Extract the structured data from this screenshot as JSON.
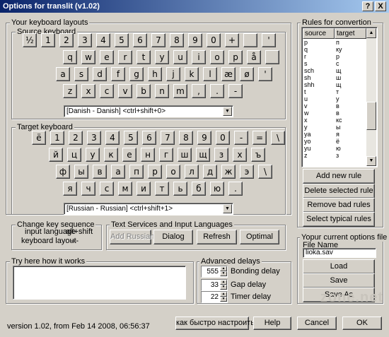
{
  "window": {
    "title": "Options for translit (v1.02)",
    "help_btn": "?",
    "close_btn": "X"
  },
  "layouts": {
    "group_label": "Your keyboard layouts",
    "source": {
      "label": "Source keyboard",
      "rows": [
        [
          "½",
          "1",
          "2",
          "3",
          "4",
          "5",
          "6",
          "7",
          "8",
          "9",
          "0",
          "+",
          "",
          "'"
        ],
        [
          "q",
          "w",
          "e",
          "r",
          "t",
          "y",
          "u",
          "i",
          "o",
          "p",
          "å",
          ""
        ],
        [
          "a",
          "s",
          "d",
          "f",
          "g",
          "h",
          "j",
          "k",
          "l",
          "æ",
          "ø",
          "'"
        ],
        [
          "z",
          "x",
          "c",
          "v",
          "b",
          "n",
          "m",
          ",",
          ".",
          "-"
        ]
      ],
      "selected": "[Danish - Danish]  <ctrl+shift+0>"
    },
    "target": {
      "label": "Target keyboard",
      "rows": [
        [
          "ё",
          "1",
          "2",
          "3",
          "4",
          "5",
          "6",
          "7",
          "8",
          "9",
          "0",
          "-",
          "=",
          "\\"
        ],
        [
          "й",
          "ц",
          "у",
          "к",
          "е",
          "н",
          "г",
          "ш",
          "щ",
          "з",
          "х",
          "ъ"
        ],
        [
          "ф",
          "ы",
          "в",
          "а",
          "п",
          "р",
          "о",
          "л",
          "д",
          "ж",
          "э",
          "\\"
        ],
        [
          "я",
          "ч",
          "с",
          "м",
          "и",
          "т",
          "ь",
          "б",
          "ю",
          "."
        ]
      ],
      "selected": "[Russian - Russian]  <ctrl+shift+1>"
    }
  },
  "key_sequence": {
    "label": "Change key sequence",
    "input_language_label": "input language",
    "input_language_value": "alt+shift",
    "keyboard_layout_label": "keyboard layout",
    "keyboard_layout_value": "---"
  },
  "text_services": {
    "label": "Text Services and Input Languages",
    "add_russian": "Add Russian",
    "dialog": "Dialog",
    "refresh": "Refresh",
    "optimal": "Optimal"
  },
  "try_here": {
    "label": "Try here how it works",
    "value": ""
  },
  "delays": {
    "label": "Advanced delays",
    "items": [
      {
        "value": "555",
        "label": "Bonding delay"
      },
      {
        "value": "33",
        "label": "Gap delay"
      },
      {
        "value": "22",
        "label": "Timer delay"
      }
    ]
  },
  "rules": {
    "label": "Rules for convertion",
    "columns": [
      "source",
      "target"
    ],
    "rows": [
      [
        "p",
        "п"
      ],
      [
        "q",
        "ку"
      ],
      [
        "r",
        "р"
      ],
      [
        "s",
        "с"
      ],
      [
        "sch",
        "щ"
      ],
      [
        "sh",
        "ш"
      ],
      [
        "shh",
        "щ"
      ],
      [
        "t",
        "т"
      ],
      [
        "u",
        "у"
      ],
      [
        "v",
        "в"
      ],
      [
        "w",
        "в"
      ],
      [
        "x",
        "кс"
      ],
      [
        "y",
        "ы"
      ],
      [
        "ya",
        "я"
      ],
      [
        "yo",
        "ё"
      ],
      [
        "yu",
        "ю"
      ],
      [
        "z",
        "з"
      ]
    ],
    "add": "Add new rule",
    "delete": "Delete selected rule",
    "remove_bad": "Remove bad rules",
    "select_typical": "Select typical rules"
  },
  "options_file": {
    "label": "Yopur current options file",
    "file_name_label": "File Name",
    "file_name": "lioka.sav",
    "load": "Load",
    "save": "Save",
    "save_as": "Save As"
  },
  "footer": {
    "version": "version 1.02, from Feb 14 2008, 06:56:37",
    "quick_setup": "как быстро настроить",
    "help": "Help",
    "cancel": "Cancel",
    "ok": "OK"
  },
  "watermark": "zone.net"
}
